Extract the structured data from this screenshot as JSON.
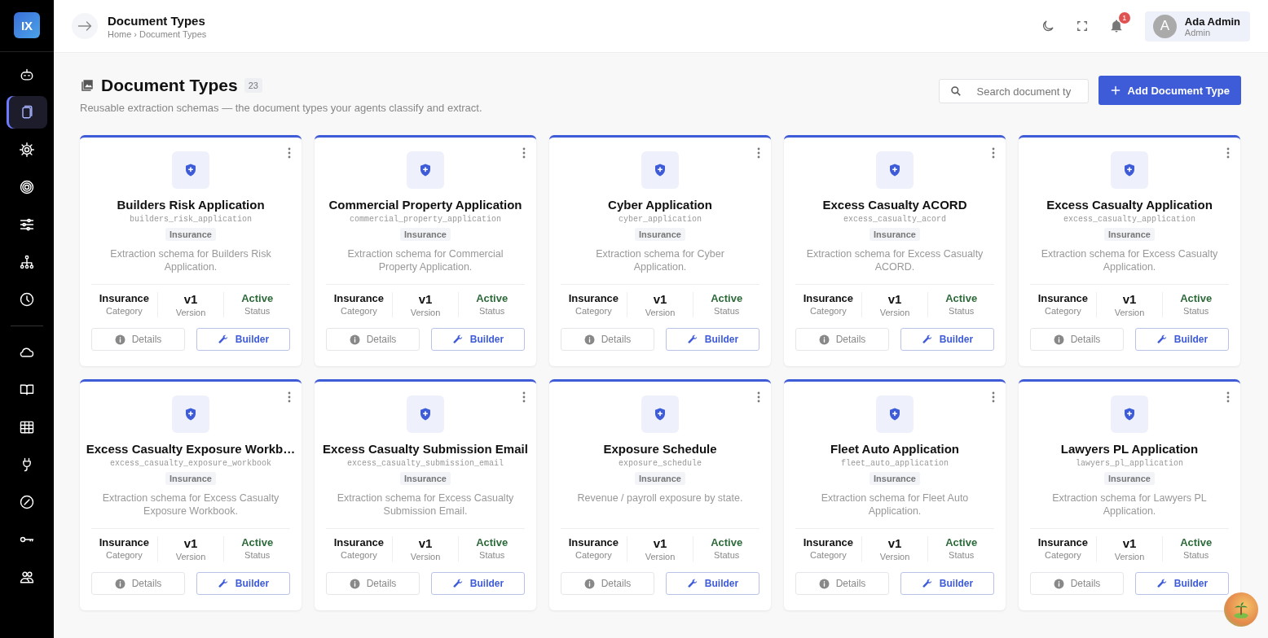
{
  "sidebar": {
    "logo": "IX",
    "groups": [
      {
        "items": [
          {
            "selected": false
          },
          {
            "selected": true
          },
          {
            "selected": false
          },
          {
            "selected": false
          },
          {
            "selected": false
          },
          {
            "selected": false
          },
          {
            "selected": false
          }
        ]
      },
      {
        "items": [
          {
            "selected": false
          },
          {
            "selected": false
          },
          {
            "selected": false
          },
          {
            "selected": false
          },
          {
            "selected": false
          },
          {
            "selected": false
          },
          {
            "selected": false
          }
        ]
      }
    ]
  },
  "header": {
    "title": "Document Types",
    "breadcrumb": [
      "Home",
      "Document Types"
    ],
    "breadcrumb_separator": "›",
    "notification_count": "1",
    "user": {
      "avatar_letter": "A",
      "name": "Ada Admin",
      "role": "Admin"
    }
  },
  "page": {
    "title": "Document Types",
    "count": "23",
    "subtitle": "Reusable extraction schemas — the document types your agents classify and extract.",
    "search": {
      "placeholder": "Search document ty"
    },
    "add_button": "Add Document Type"
  },
  "cards": [
    {
      "title": "Builders Risk Application",
      "slug": "builders_risk_application",
      "tag": "Insurance",
      "description": "Extraction schema for Builders Risk Application.",
      "stats": [
        {
          "kind": "category",
          "value": "Insurance",
          "label": "Category"
        },
        {
          "kind": "version",
          "value": "v1",
          "label": "Version"
        },
        {
          "kind": "status",
          "value": "Active",
          "label": "Status"
        }
      ],
      "details": "Details",
      "builder": "Builder"
    },
    {
      "title": "Commercial Property Application",
      "slug": "commercial_property_application",
      "tag": "Insurance",
      "description": "Extraction schema for Commercial Property Application.",
      "stats": [
        {
          "kind": "category",
          "value": "Insurance",
          "label": "Category"
        },
        {
          "kind": "version",
          "value": "v1",
          "label": "Version"
        },
        {
          "kind": "status",
          "value": "Active",
          "label": "Status"
        }
      ],
      "details": "Details",
      "builder": "Builder"
    },
    {
      "title": "Cyber Application",
      "slug": "cyber_application",
      "tag": "Insurance",
      "description": "Extraction schema for Cyber Application.",
      "stats": [
        {
          "kind": "category",
          "value": "Insurance",
          "label": "Category"
        },
        {
          "kind": "version",
          "value": "v1",
          "label": "Version"
        },
        {
          "kind": "status",
          "value": "Active",
          "label": "Status"
        }
      ],
      "details": "Details",
      "builder": "Builder"
    },
    {
      "title": "Excess Casualty ACORD",
      "slug": "excess_casualty_acord",
      "tag": "Insurance",
      "description": "Extraction schema for Excess Casualty ACORD.",
      "stats": [
        {
          "kind": "category",
          "value": "Insurance",
          "label": "Category"
        },
        {
          "kind": "version",
          "value": "v1",
          "label": "Version"
        },
        {
          "kind": "status",
          "value": "Active",
          "label": "Status"
        }
      ],
      "details": "Details",
      "builder": "Builder"
    },
    {
      "title": "Excess Casualty Application",
      "slug": "excess_casualty_application",
      "tag": "Insurance",
      "description": "Extraction schema for Excess Casualty Application.",
      "stats": [
        {
          "kind": "category",
          "value": "Insurance",
          "label": "Category"
        },
        {
          "kind": "version",
          "value": "v1",
          "label": "Version"
        },
        {
          "kind": "status",
          "value": "Active",
          "label": "Status"
        }
      ],
      "details": "Details",
      "builder": "Builder"
    },
    {
      "title": "Excess Casualty Exposure Workb…",
      "slug": "excess_casualty_exposure_workbook",
      "tag": "Insurance",
      "description": "Extraction schema for Excess Casualty Exposure Workbook.",
      "stats": [
        {
          "kind": "category",
          "value": "Insurance",
          "label": "Category"
        },
        {
          "kind": "version",
          "value": "v1",
          "label": "Version"
        },
        {
          "kind": "status",
          "value": "Active",
          "label": "Status"
        }
      ],
      "details": "Details",
      "builder": "Builder"
    },
    {
      "title": "Excess Casualty Submission Email",
      "slug": "excess_casualty_submission_email",
      "tag": "Insurance",
      "description": "Extraction schema for Excess Casualty Submission Email.",
      "stats": [
        {
          "kind": "category",
          "value": "Insurance",
          "label": "Category"
        },
        {
          "kind": "version",
          "value": "v1",
          "label": "Version"
        },
        {
          "kind": "status",
          "value": "Active",
          "label": "Status"
        }
      ],
      "details": "Details",
      "builder": "Builder"
    },
    {
      "title": "Exposure Schedule",
      "slug": "exposure_schedule",
      "tag": "Insurance",
      "description": "Revenue / payroll exposure by state.",
      "stats": [
        {
          "kind": "category",
          "value": "Insurance",
          "label": "Category"
        },
        {
          "kind": "version",
          "value": "v1",
          "label": "Version"
        },
        {
          "kind": "status",
          "value": "Active",
          "label": "Status"
        }
      ],
      "details": "Details",
      "builder": "Builder"
    },
    {
      "title": "Fleet Auto Application",
      "slug": "fleet_auto_application",
      "tag": "Insurance",
      "description": "Extraction schema for Fleet Auto Application.",
      "stats": [
        {
          "kind": "category",
          "value": "Insurance",
          "label": "Category"
        },
        {
          "kind": "version",
          "value": "v1",
          "label": "Version"
        },
        {
          "kind": "status",
          "value": "Active",
          "label": "Status"
        }
      ],
      "details": "Details",
      "builder": "Builder"
    },
    {
      "title": "Lawyers PL Application",
      "slug": "lawyers_pl_application",
      "tag": "Insurance",
      "description": "Extraction schema for Lawyers PL Application.",
      "stats": [
        {
          "kind": "category",
          "value": "Insurance",
          "label": "Category"
        },
        {
          "kind": "version",
          "value": "v1",
          "label": "Version"
        },
        {
          "kind": "status",
          "value": "Active",
          "label": "Status"
        }
      ],
      "details": "Details",
      "builder": "Builder"
    }
  ]
}
